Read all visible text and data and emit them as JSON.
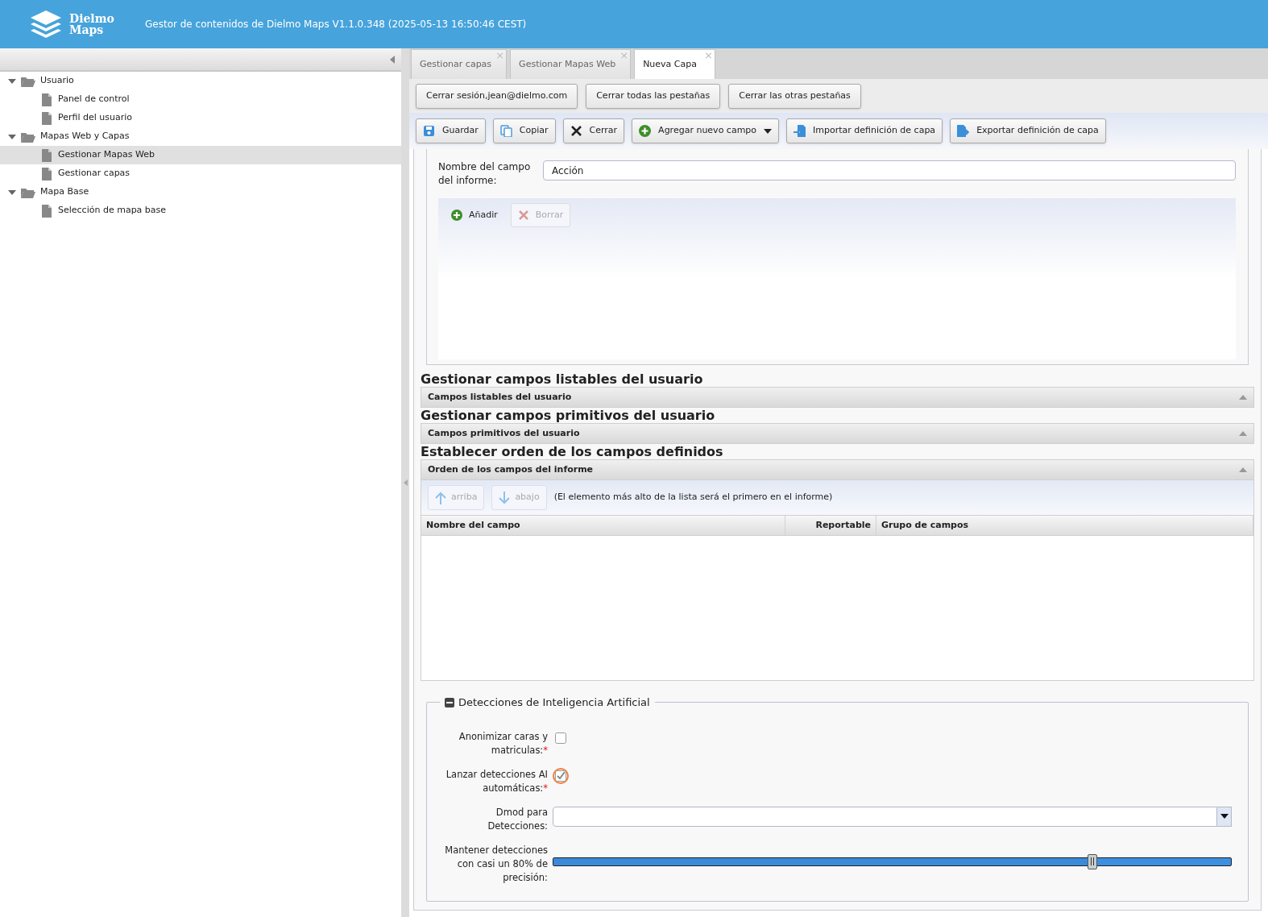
{
  "header": {
    "logo_line1": "Dielmo",
    "logo_line2": "Maps",
    "title": "Gestor de contenidos de Dielmo Maps V1.1.0.348 (2025-05-13 16:50:46 CEST)"
  },
  "sidebar": {
    "tree": [
      {
        "label": "Usuario",
        "expanded": true,
        "selected": false,
        "children": [
          {
            "label": "Panel de control",
            "selected": false
          },
          {
            "label": "Perfil del usuario",
            "selected": false
          }
        ]
      },
      {
        "label": "Mapas Web y Capas",
        "expanded": true,
        "selected": false,
        "children": [
          {
            "label": "Gestionar Mapas Web",
            "selected": true
          },
          {
            "label": "Gestionar capas",
            "selected": false
          }
        ]
      },
      {
        "label": "Mapa Base",
        "expanded": true,
        "selected": false,
        "children": [
          {
            "label": "Selección de mapa base",
            "selected": false
          }
        ]
      }
    ]
  },
  "tabs": [
    {
      "label": "Gestionar capas",
      "selected": false,
      "close": "×"
    },
    {
      "label": "Gestionar Mapas Web",
      "selected": false,
      "close": "×"
    },
    {
      "label": "Nueva Capa",
      "selected": true,
      "close": "×"
    }
  ],
  "session_buttons": [
    "Cerrar sesión,jean@dielmo.com",
    "Cerrar todas las pestañas",
    "Cerrar las otras pestañas"
  ],
  "toolbar": [
    {
      "label": "Guardar",
      "kind": "save"
    },
    {
      "label": "Copiar",
      "kind": "copy"
    },
    {
      "label": "Cerrar",
      "kind": "close"
    },
    {
      "label": "Agregar nuevo campo",
      "kind": "add"
    },
    {
      "label": "Importar definición de capa",
      "kind": "import"
    },
    {
      "label": "Exportar definición de capa",
      "kind": "export"
    }
  ],
  "report_field": {
    "label": "Nombre del campo del informe:",
    "value": "Acción",
    "add": {
      "label": "Añadir",
      "disabled": false
    },
    "delete": {
      "label": "Borrar",
      "disabled": true
    }
  },
  "sections": [
    {
      "heading": "Gestionar campos listables del usuario",
      "panel": "Campos listables del usuario"
    },
    {
      "heading": "Gestionar campos primitivos del usuario",
      "panel": "Campos primitivos del usuario"
    }
  ],
  "order": {
    "heading": "Establecer orden de los campos definidos",
    "panel": "Orden de los campos del informe",
    "up": {
      "label": "arriba",
      "disabled": true
    },
    "down": {
      "label": "abajo",
      "disabled": true
    },
    "note": "(El elemento más alto de la lista será el primero en el informe)",
    "columns": [
      "Nombre del campo",
      "Reportable",
      "Grupo de campos"
    ]
  },
  "ai": {
    "legend": "Detecciones de Inteligencia Artificial",
    "expanded": true,
    "fields": [
      {
        "kind": "checkbox",
        "label": "Anonimizar caras y matriculas:",
        "required_mark": "*",
        "checked": false,
        "focused": false
      },
      {
        "kind": "checkbox",
        "label": "Lanzar detecciones AI automáticas:",
        "required_mark": "*",
        "checked": true,
        "focused": true
      },
      {
        "kind": "select",
        "label": "Dmod para Detecciones:"
      },
      {
        "kind": "slider",
        "label": "Mantener detecciones con casi un 80% de precisión:",
        "level": 0.795
      }
    ]
  }
}
